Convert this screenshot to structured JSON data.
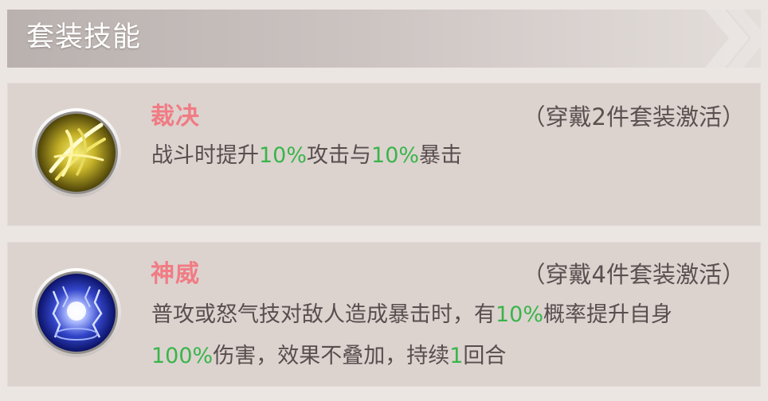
{
  "header": {
    "title": "套装技能"
  },
  "skills": [
    {
      "name": "裁决",
      "condition": "（穿戴2件套装激活）",
      "icon": "golden-slash-skill-icon",
      "desc": [
        {
          "t": "战斗时提升",
          "hl": false
        },
        {
          "t": "10%",
          "hl": true
        },
        {
          "t": "攻击与",
          "hl": false
        },
        {
          "t": "10%",
          "hl": true
        },
        {
          "t": "暴击",
          "hl": false
        }
      ]
    },
    {
      "name": "神威",
      "condition": "（穿戴4件套装激活）",
      "icon": "lightning-orb-skill-icon",
      "desc": [
        {
          "t": "普攻或怒气技对敌人造成暴击时，有",
          "hl": false
        },
        {
          "t": "10%",
          "hl": true
        },
        {
          "t": "概率提升自身",
          "hl": false
        },
        {
          "t": "100%",
          "hl": true
        },
        {
          "t": "伤害，效果不叠加，持续",
          "hl": false
        },
        {
          "t": "1",
          "hl": true
        },
        {
          "t": "回合",
          "hl": false
        }
      ]
    }
  ],
  "colors": {
    "skill_name": "#f07c84",
    "highlight": "#39b54a",
    "text": "#584e4e"
  }
}
